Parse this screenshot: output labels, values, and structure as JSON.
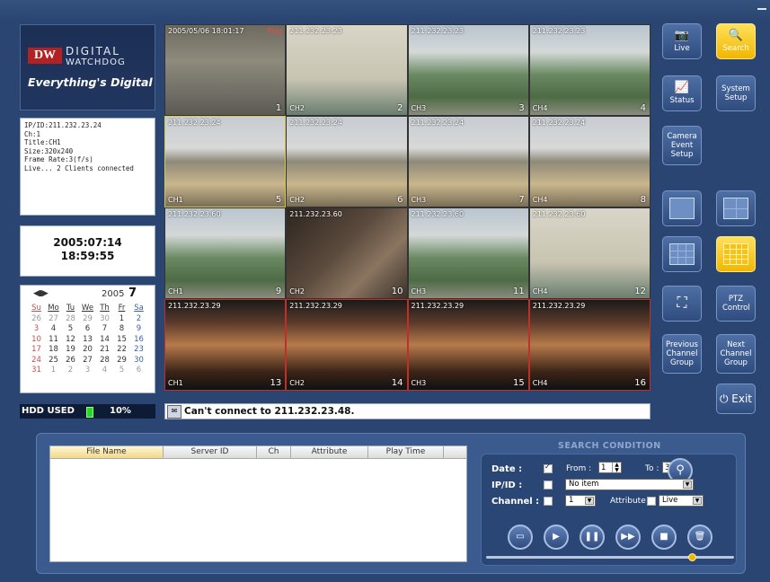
{
  "logo": {
    "brand_mark": "DW",
    "line1": "DIGITAL",
    "line2": "WATCHDOG",
    "tagline": "Everything's Digital"
  },
  "info": {
    "lines": [
      "IP/ID:211.232.23.24",
      "Ch:1",
      "Title:CH1",
      "Size:320x240",
      "Frame Rate:3(f/s)",
      "Live... 2 Clients connected"
    ]
  },
  "datetime": {
    "date": "2005:07:14",
    "time": "18:59:55"
  },
  "calendar": {
    "nav": "◀▮▶",
    "year": "2005",
    "month": "7",
    "weekdays": [
      "Su",
      "Mo",
      "Tu",
      "We",
      "Th",
      "Fr",
      "Sa"
    ],
    "days": [
      "26",
      "27",
      "28",
      "29",
      "30",
      "1",
      "2",
      "3",
      "4",
      "5",
      "6",
      "7",
      "8",
      "9",
      "10",
      "11",
      "12",
      "13",
      "14",
      "15",
      "16",
      "17",
      "18",
      "19",
      "20",
      "21",
      "22",
      "23",
      "24",
      "25",
      "26",
      "27",
      "28",
      "29",
      "30",
      "31",
      "1",
      "2",
      "3",
      "4",
      "5",
      "6"
    ]
  },
  "hdd": {
    "label": "HDD USED",
    "value": "10%",
    "fraction": 0.1,
    "bar_color": "#2bd42b"
  },
  "video": {
    "cells": [
      {
        "ip": "2005/05/06 18:01:17",
        "play": "Play",
        "ch": "",
        "num": "1",
        "scene": "room",
        "state": "normal"
      },
      {
        "ip": "211.232.23.23",
        "play": "",
        "ch": "CH2",
        "num": "2",
        "scene": "fish",
        "state": "normal"
      },
      {
        "ip": "211.232.23.23",
        "play": "",
        "ch": "CH3",
        "num": "3",
        "scene": "park",
        "state": "normal"
      },
      {
        "ip": "211.232.23.23",
        "play": "",
        "ch": "CH4",
        "num": "4",
        "scene": "park",
        "state": "normal"
      },
      {
        "ip": "211.232.23.24",
        "play": "",
        "ch": "CH1",
        "num": "5",
        "scene": "office",
        "state": "selected"
      },
      {
        "ip": "211.232.23.24",
        "play": "",
        "ch": "CH2",
        "num": "6",
        "scene": "office",
        "state": "normal"
      },
      {
        "ip": "211.232.23.24",
        "play": "",
        "ch": "CH3",
        "num": "7",
        "scene": "office",
        "state": "normal"
      },
      {
        "ip": "211.232.23.24",
        "play": "",
        "ch": "CH4",
        "num": "8",
        "scene": "office",
        "state": "normal"
      },
      {
        "ip": "211.232.23.60",
        "play": "",
        "ch": "CH1",
        "num": "9",
        "scene": "park",
        "state": "normal"
      },
      {
        "ip": "211.232.23.60",
        "play": "",
        "ch": "CH2",
        "num": "10",
        "scene": "movie",
        "state": "normal"
      },
      {
        "ip": "211.232.23.60",
        "play": "",
        "ch": "CH3",
        "num": "11",
        "scene": "park",
        "state": "normal"
      },
      {
        "ip": "211.232.23.60",
        "play": "",
        "ch": "CH4",
        "num": "12",
        "scene": "fish",
        "state": "normal"
      },
      {
        "ip": "211.232.23.29",
        "play": "",
        "ch": "CH1",
        "num": "13",
        "scene": "face",
        "state": "recording"
      },
      {
        "ip": "211.232.23.29",
        "play": "",
        "ch": "CH2",
        "num": "14",
        "scene": "face",
        "state": "recording"
      },
      {
        "ip": "211.232.23.29",
        "play": "",
        "ch": "CH3",
        "num": "15",
        "scene": "face",
        "state": "recording"
      },
      {
        "ip": "211.232.23.29",
        "play": "",
        "ch": "CH4",
        "num": "16",
        "scene": "face",
        "state": "recording"
      }
    ]
  },
  "right_panel": {
    "live": "Live",
    "search": "Search",
    "status": "Status",
    "system_setup": "System Setup",
    "camera_event_setup": "Camera Event Setup",
    "ptz_control": "PTZ Control",
    "previous_group": "Previous Channel Group",
    "next_group": "Next Channel Group",
    "exit": "⏻ Exit"
  },
  "status_bar": {
    "message": "Can't connect to 211.232.23.48."
  },
  "file_table": {
    "columns": [
      "File Name",
      "Server ID",
      "Ch",
      "Attribute",
      "Play Time"
    ],
    "rows": []
  },
  "search": {
    "title": "SEARCH CONDITION",
    "date_label": "Date   :",
    "date_checked": true,
    "from_label": "From :",
    "from_value": "1",
    "to_label": "To :",
    "to_value": "31",
    "ipid_label": "IP/ID   :",
    "ipid_value": "No item",
    "channel_label": "Channel :",
    "channel_value": "1",
    "attribute_label": "Attribute",
    "attribute_value": "Live",
    "slider_fraction": 0.83
  },
  "colors": {
    "background": "#2a4572",
    "accent_active": "#f2b600",
    "recording_border": "#c0302b"
  }
}
